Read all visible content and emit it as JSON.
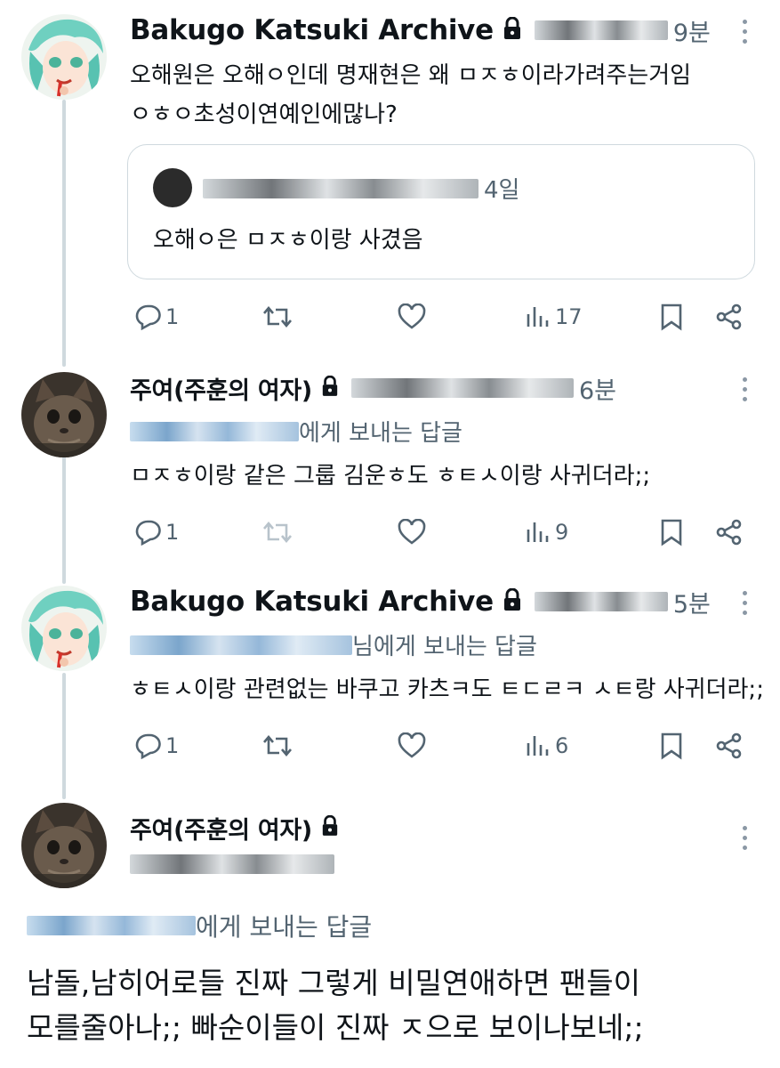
{
  "tweets": [
    {
      "name": "Bakugo Katsuki Archive",
      "time": "9분",
      "body": [
        "오해원은 오해ㅇ인데 명재현은 왜 ㅁㅈㅎ이라가려주는거임",
        "ㅇㅎㅇ초성이연예인에많나?"
      ],
      "quote": {
        "time": "4일",
        "text": "오해ㅇ은 ㅁㅈㅎ이랑 사겼음"
      },
      "stats": {
        "replies": "1",
        "views": "17"
      }
    },
    {
      "name": "주여(주훈의 여자)",
      "time": "6분",
      "reply_suffix": "에게 보내는 답글",
      "body": [
        "ㅁㅈㅎ이랑 같은 그룹 김운ㅎ도 ㅎㅌㅅ이랑 사귀더라;;"
      ],
      "stats": {
        "replies": "1",
        "views": "9"
      }
    },
    {
      "name": "Bakugo Katsuki Archive",
      "time": "5분",
      "reply_suffix": "님에게 보내는 답글",
      "body": [
        "ㅎㅌㅅ이랑 관련없는 바쿠고 카츠ㅋ도 ㅌㄷㄹㅋ ㅅㅌ랑 사귀더라;;"
      ],
      "stats": {
        "replies": "1",
        "views": "6"
      }
    },
    {
      "name": "주여(주훈의 여자)",
      "reply_suffix": "에게 보내는 답글",
      "body": [
        "남돌,남히어로들 진짜 그렇게 비밀연애하면 팬들이",
        "모를줄아나;; 빠순이들이 진짜 ㅈ으로 보이나보네;;"
      ]
    }
  ],
  "icons": [
    "reply-icon",
    "retweet-icon",
    "like-icon",
    "views-icon",
    "bookmark-icon",
    "share-icon",
    "lock-icon",
    "more-icon"
  ],
  "colors": {
    "text": "#0f1419",
    "secondary": "#536471",
    "thread_line": "#cfd9de",
    "border": "#cfd9de"
  }
}
